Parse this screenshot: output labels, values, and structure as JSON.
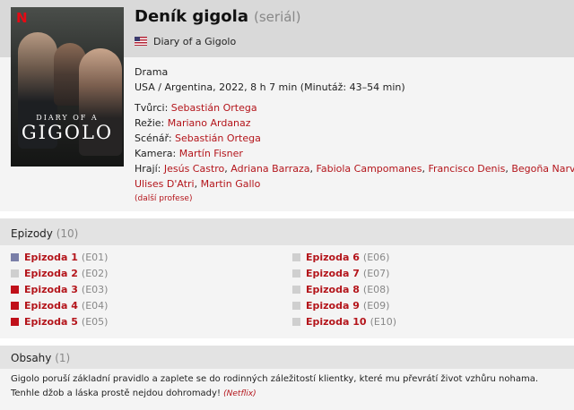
{
  "header": {
    "title": "Deník gigola",
    "type": "(seriál)",
    "original_title": "Diary of a Gigolo",
    "flag_icon": "us-flag-icon"
  },
  "poster": {
    "brand": "N",
    "line1": "DIARY OF A",
    "line2": "GIGOLO"
  },
  "info": {
    "genre": "Drama",
    "origin": "USA / Argentina, 2022, 8 h 7 min (Minutáž: 43–54 min)",
    "creators_label": "Tvůrci:",
    "creators": "Sebastián Ortega",
    "director_label": "Režie:",
    "director": "Mariano Ardanaz",
    "writer_label": "Scénář:",
    "writer": "Sebastián Ortega",
    "camera_label": "Kamera:",
    "camera": "Martín Fisner",
    "cast_label": "Hrají:",
    "cast": [
      "Jesús Castro",
      "Adriana Barraza",
      "Fabiola Campomanes",
      "Francisco Denis",
      "Begoña Narváez",
      "Ulises D'Atri",
      "Martin Gallo"
    ],
    "more_label": "(další profese)"
  },
  "episodes": {
    "title": "Epizody",
    "count": "(10)",
    "items": [
      {
        "label": "Epizoda 1",
        "code": "(E01)",
        "status": "watched",
        "color": "#7a7fa8"
      },
      {
        "label": "Epizoda 2",
        "code": "(E02)",
        "status": "none",
        "color": "#cfcfcf"
      },
      {
        "label": "Epizoda 3",
        "code": "(E03)",
        "status": "rated",
        "color": "#c0101a"
      },
      {
        "label": "Epizoda 4",
        "code": "(E04)",
        "status": "rated",
        "color": "#c0101a"
      },
      {
        "label": "Epizoda 5",
        "code": "(E05)",
        "status": "rated",
        "color": "#c0101a"
      },
      {
        "label": "Epizoda 6",
        "code": "(E06)",
        "status": "none",
        "color": "#cfcfcf"
      },
      {
        "label": "Epizoda 7",
        "code": "(E07)",
        "status": "none",
        "color": "#cfcfcf"
      },
      {
        "label": "Epizoda 8",
        "code": "(E08)",
        "status": "none",
        "color": "#cfcfcf"
      },
      {
        "label": "Epizoda 9",
        "code": "(E09)",
        "status": "none",
        "color": "#cfcfcf"
      },
      {
        "label": "Epizoda 10",
        "code": "(E10)",
        "status": "none",
        "color": "#cfcfcf"
      }
    ]
  },
  "plot": {
    "title": "Obsahy",
    "count": "(1)",
    "text": "Gigolo poruší základní pravidlo a zaplete se do rodinných záležitostí klientky, které mu převrátí život vzhůru nohama. Tenhle džob a láska prostě nejdou dohromady!",
    "source": "(Netflix)"
  },
  "colors": {
    "link": "#b4151b",
    "header_bg": "#d9d9d9",
    "section_bg": "#f4f4f4"
  }
}
